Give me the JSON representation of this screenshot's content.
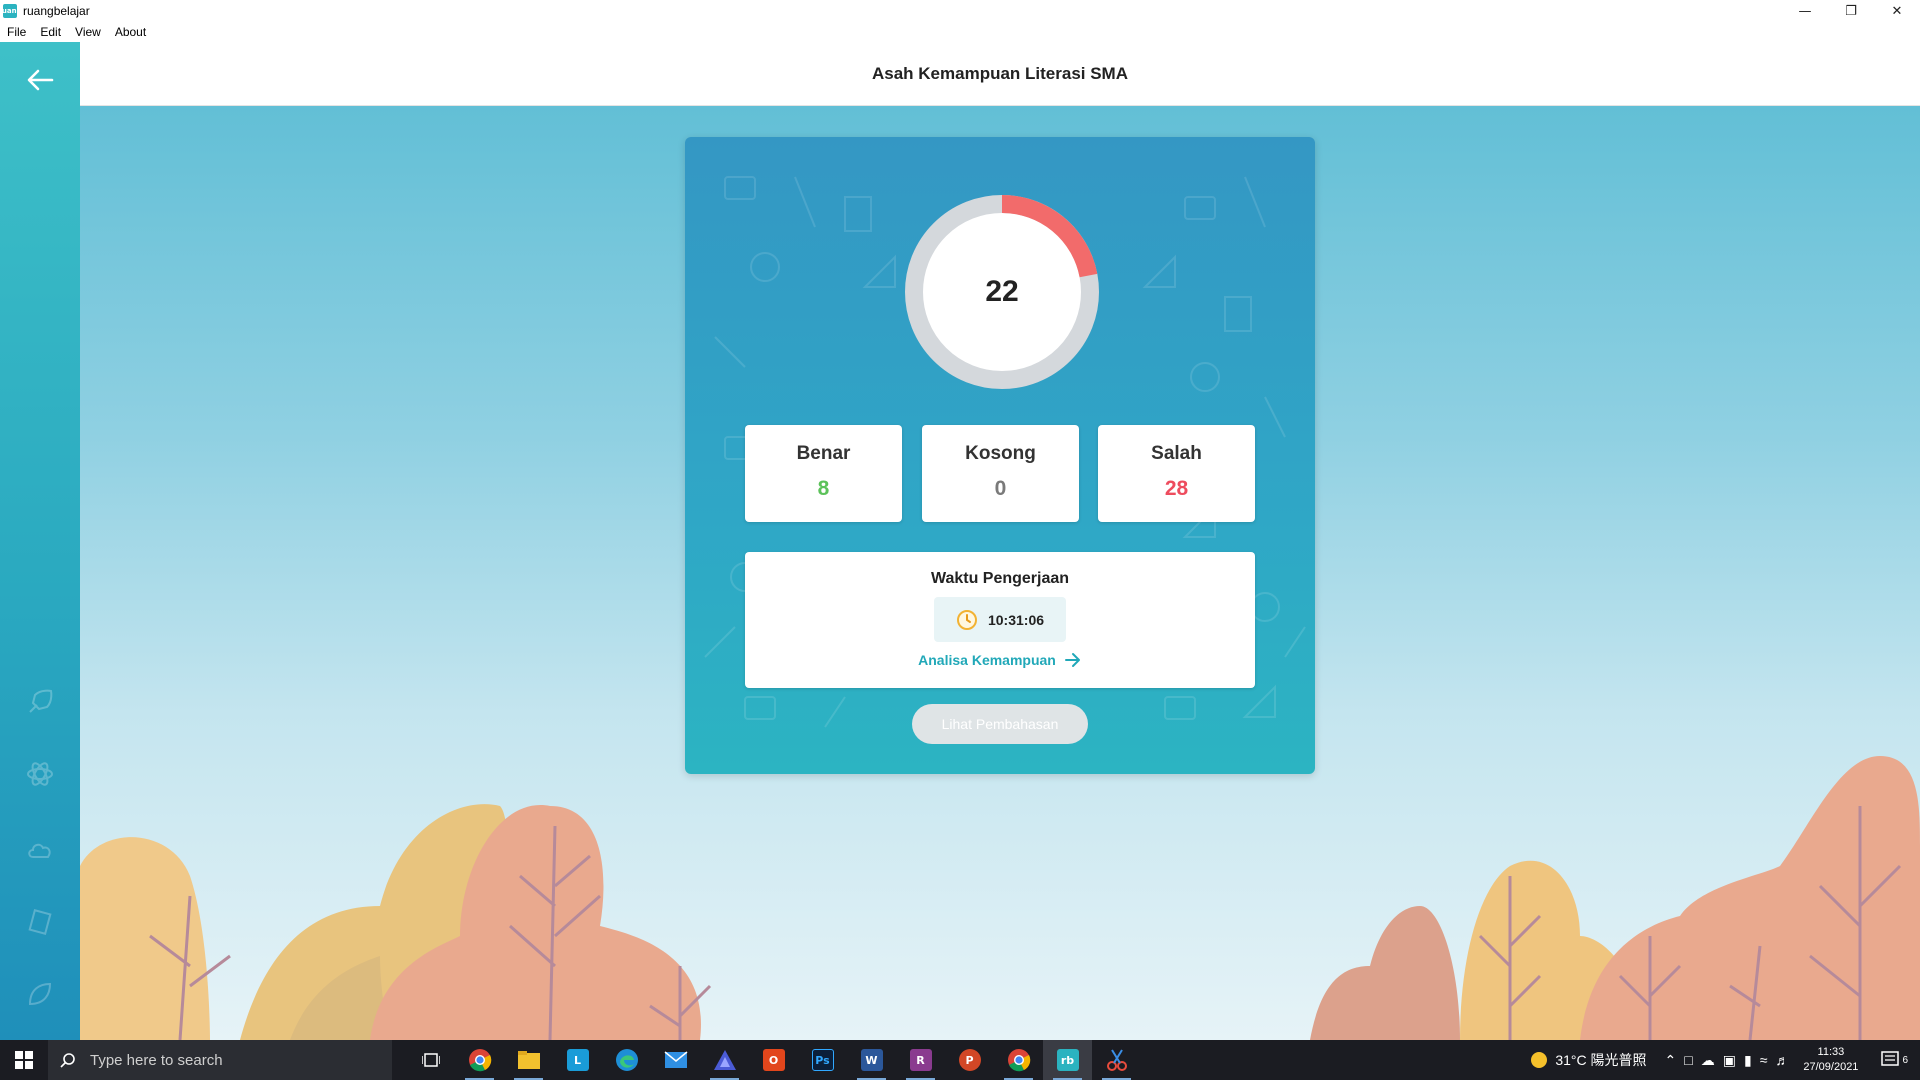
{
  "window": {
    "title": "ruangbelajar",
    "icon_text": "ruang",
    "controls": [
      "minimize",
      "restore",
      "close"
    ]
  },
  "menu": [
    "File",
    "Edit",
    "View",
    "About"
  ],
  "header": {
    "title": "Asah Kemampuan Literasi SMA",
    "back_icon": "arrow-left-icon"
  },
  "result": {
    "score": "22",
    "progress_fraction": 0.22,
    "colors": {
      "progress": "#f26b6b",
      "track": "#d4d8dc"
    },
    "stats": [
      {
        "label": "Benar",
        "value": "8",
        "color": "#5cc25a"
      },
      {
        "label": "Kosong",
        "value": "0",
        "color": "#7a7a7a"
      },
      {
        "label": "Salah",
        "value": "28",
        "color": "#ee4c5e"
      }
    ],
    "time": {
      "title": "Waktu Pengerjaan",
      "value": "10:31:06",
      "icon": "clock-icon"
    },
    "analysis_link": "Analisa Kemampuan",
    "discussion_button": "Lihat Pembahasan"
  },
  "taskbar": {
    "search_placeholder": "Type here to search",
    "apps": [
      "task-view",
      "chrome",
      "file-explorer",
      "lumina",
      "edge",
      "mail",
      "affinity",
      "office",
      "photoshop",
      "word",
      "winrar",
      "powerpoint",
      "chrome-profile",
      "ruangbelajar",
      "snipping"
    ],
    "weather": "31°C 陽光普照",
    "time": "11:33",
    "date": "27/09/2021",
    "notifications": "6"
  }
}
